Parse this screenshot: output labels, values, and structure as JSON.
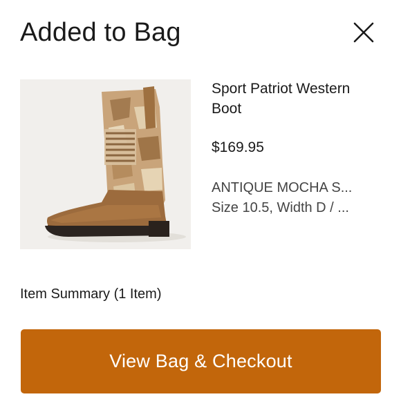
{
  "header": {
    "title": "Added to Bag",
    "close_icon": "close-icon"
  },
  "product": {
    "image_icon": "western-boot-image",
    "name_line1": "Sport Patriot Western",
    "name_line2": "Boot",
    "price": "$169.95",
    "variant_line1": "ANTIQUE MOCHA S...",
    "variant_line2": "Size 10.5, Width D / ..."
  },
  "summary": {
    "label": "Item Summary (1 Item)"
  },
  "actions": {
    "checkout_label": "View Bag & Checkout"
  },
  "colors": {
    "accent": "#c2660b",
    "text": "#1a1a1a",
    "image_bg": "#f1efec"
  }
}
